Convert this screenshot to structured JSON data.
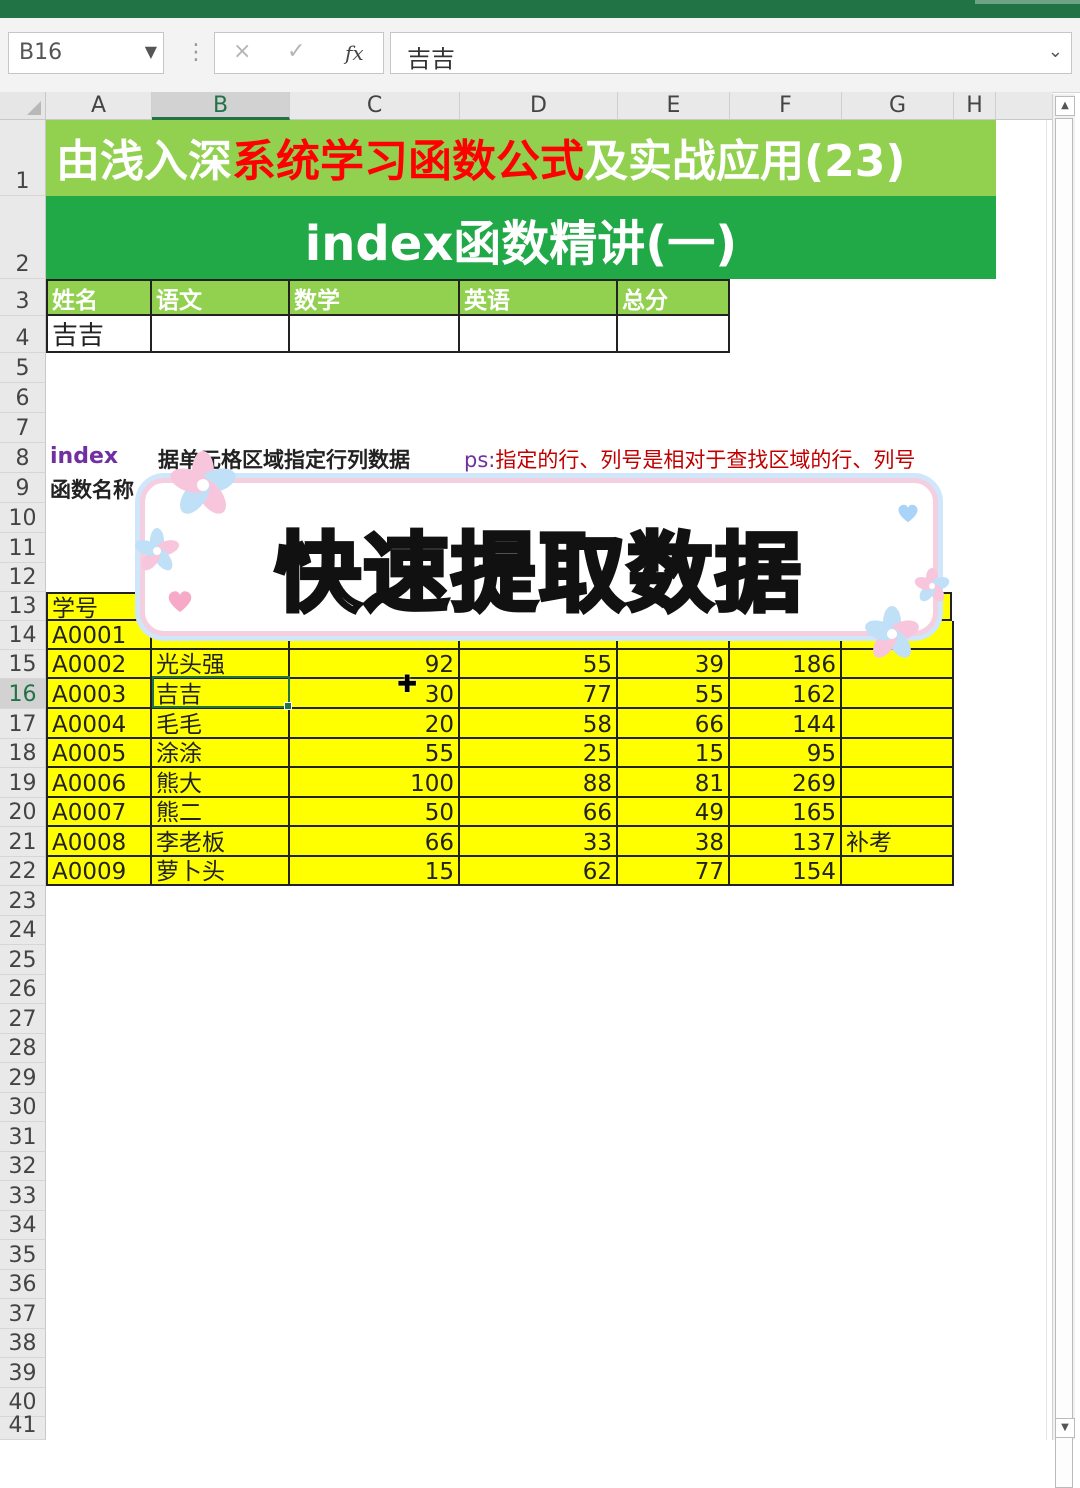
{
  "formula_bar": {
    "name_box": "B16",
    "cancel_icon": "×",
    "enter_icon": "✓",
    "fx_label": "fx",
    "formula_value": "吉吉"
  },
  "columns": [
    "A",
    "B",
    "C",
    "D",
    "E",
    "F",
    "G",
    "H"
  ],
  "selected_column": "B",
  "rows": [
    "1",
    "2",
    "3",
    "4",
    "5",
    "6",
    "7",
    "8",
    "9",
    "10",
    "11",
    "12",
    "13",
    "14",
    "15",
    "16",
    "17",
    "18",
    "19",
    "20",
    "21",
    "22",
    "23",
    "24",
    "25",
    "26",
    "27",
    "28",
    "29",
    "30",
    "31",
    "32",
    "33",
    "34",
    "35",
    "36",
    "37",
    "38",
    "39",
    "40",
    "41"
  ],
  "selected_row": "16",
  "title": {
    "part1": "由浅入深",
    "part2": "系统学习函数公式",
    "part3": "及实战应用(23)",
    "subtitle": "index函数精讲(一)"
  },
  "lookup_table": {
    "headers": [
      "姓名",
      "语文",
      "数学",
      "英语",
      "总分"
    ],
    "row": [
      "吉吉",
      "",
      "",
      "",
      ""
    ]
  },
  "notes": {
    "func_name": "index",
    "func_desc": "据单元格区域指定行列数据",
    "ps_label": "ps:",
    "ps_text": "指定的行、列号是相对于查找区域的行、列号",
    "row9_label": "函数名称"
  },
  "data_table": {
    "header_id": "学号",
    "partial_row14_id": "A0001",
    "rows": [
      {
        "id": "A0002",
        "name": "光头强",
        "c": "92",
        "d": "55",
        "e": "39",
        "f": "186",
        "g": ""
      },
      {
        "id": "A0003",
        "name": "吉吉",
        "c": "30",
        "d": "77",
        "e": "55",
        "f": "162",
        "g": ""
      },
      {
        "id": "A0004",
        "name": "毛毛",
        "c": "20",
        "d": "58",
        "e": "66",
        "f": "144",
        "g": ""
      },
      {
        "id": "A0005",
        "name": "涂涂",
        "c": "55",
        "d": "25",
        "e": "15",
        "f": "95",
        "g": ""
      },
      {
        "id": "A0006",
        "name": "熊大",
        "c": "100",
        "d": "88",
        "e": "81",
        "f": "269",
        "g": ""
      },
      {
        "id": "A0007",
        "name": "熊二",
        "c": "50",
        "d": "66",
        "e": "49",
        "f": "165",
        "g": ""
      },
      {
        "id": "A0008",
        "name": "李老板",
        "c": "66",
        "d": "33",
        "e": "38",
        "f": "137",
        "g": "补考"
      },
      {
        "id": "A0009",
        "name": "萝卜头",
        "c": "15",
        "d": "62",
        "e": "77",
        "f": "154",
        "g": ""
      }
    ]
  },
  "overlay": {
    "title": "快速提取数据"
  },
  "colors": {
    "excel_green": "#217346",
    "title_green": "#92d050",
    "subtitle_green": "#21a847",
    "highlight_red": "#ff0000",
    "table_yellow": "#ffff00"
  }
}
